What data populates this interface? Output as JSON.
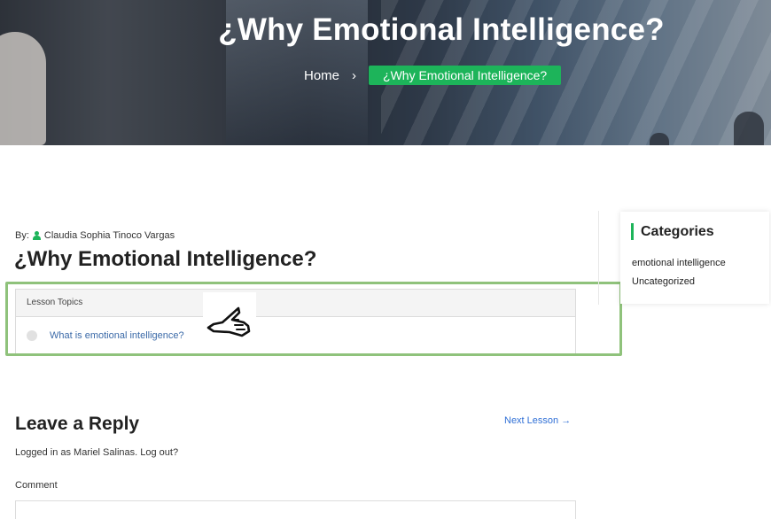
{
  "hero": {
    "title": "¿Why Emotional Intelligence?",
    "breadcrumb_home": "Home",
    "breadcrumb_separator": "›",
    "breadcrumb_current": "¿Why Emotional Intelligence?"
  },
  "post": {
    "by_label": "By:",
    "author": "Claudia Sophia Tinoco Vargas",
    "title": "¿Why Emotional Intelligence?"
  },
  "lesson_topics": {
    "header": "Lesson Topics",
    "items": [
      "What is emotional intelligence?"
    ]
  },
  "sidebar": {
    "title": "Categories",
    "items": [
      "emotional intelligence",
      "Uncategorized"
    ]
  },
  "reply": {
    "title": "Leave a Reply",
    "next_lesson": "Next Lesson →",
    "logged_in": "Logged in as Mariel Salinas. Log out?",
    "comment_label": "Comment",
    "comment_value": ""
  },
  "colors": {
    "accent_green": "#1db45a",
    "highlight_green": "#8fc27b",
    "link_blue": "#2f6fd6"
  }
}
